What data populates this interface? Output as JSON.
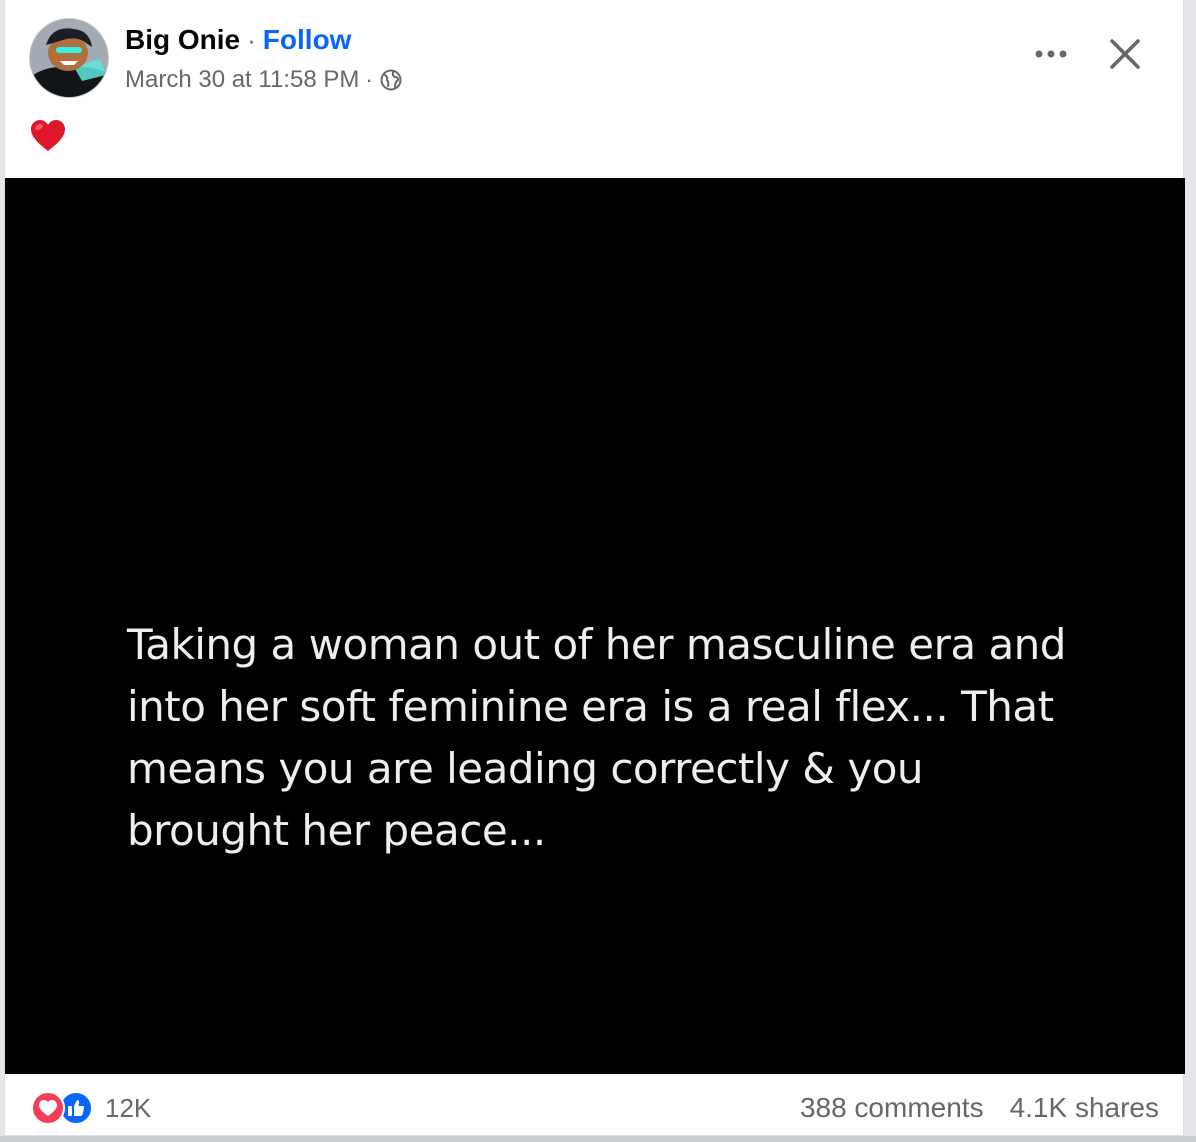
{
  "post": {
    "author": "Big Onie",
    "separator": "·",
    "follow_label": "Follow",
    "timestamp": "March 30 at 11:58 PM",
    "audience_icon": "globe-icon",
    "caption_emoji": "❤️",
    "more_icon": "more-options-icon",
    "close_icon": "close-icon",
    "image_text": "Taking a woman out of her masculine era and into her soft feminine era is a real flex... That means you are leading correctly & you brought her peace..."
  },
  "footer": {
    "reaction_icons": [
      "love-reaction-icon",
      "like-reaction-icon"
    ],
    "reaction_count": "12K",
    "comments": "388 comments",
    "shares": "4.1K shares"
  },
  "colors": {
    "accent": "#0866ff",
    "secondary_text": "#65676b",
    "love": "#f33e58",
    "like": "#0866ff",
    "media_bg": "#000000"
  }
}
